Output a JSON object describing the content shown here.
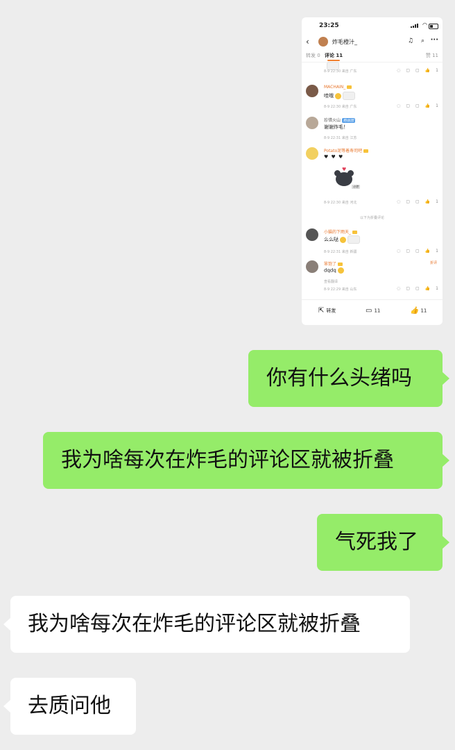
{
  "screenshot": {
    "status_time": "23:25",
    "nav_title": "炸毛橙汁_",
    "tabs": {
      "repost": "转发 0",
      "comments": "评论 11",
      "likes": "赞 11"
    },
    "comments": [
      {
        "name": "",
        "text": "",
        "meta": "8-9 22:30 来自 广东",
        "likes": "1"
      },
      {
        "name": "MACHAIN_",
        "text": "哇哦",
        "meta": "8-9 22:30 来自 广东",
        "likes": "1"
      },
      {
        "name": "珍惜火山",
        "tag": "粉丝团",
        "text": "谢谢炸毛！",
        "meta": "8-9 22:31 来自 江苏",
        "likes": "1"
      },
      {
        "name": "Potato泥等着寿司吧",
        "text": "",
        "meta": "8-9 22:30 来自 河北",
        "likes": "1",
        "sticker_label": "必胜"
      },
      {
        "name": "小猫的下雨天_",
        "text": "么么哒",
        "meta": "8-9 22:31 来自 新疆",
        "likes": "1"
      },
      {
        "name": "笨饱了",
        "text": "dqdq",
        "meta": "8-9 22:29 来自 山东",
        "likes": "1",
        "translate": "查看翻译",
        "folded_tag": "折评"
      }
    ],
    "divider": "以下为折叠评论",
    "bottom": {
      "repost": "转发",
      "comment": "11",
      "like": "11"
    }
  },
  "messages": [
    {
      "side": "out",
      "text": "你有什么头绪吗"
    },
    {
      "side": "out",
      "text": "我为啥每次在炸毛的评论区就被折叠"
    },
    {
      "side": "out",
      "text": "气死我了"
    },
    {
      "side": "in",
      "text": "我为啥每次在炸毛的评论区就被折叠"
    },
    {
      "side": "in",
      "text": "去质问他"
    }
  ]
}
